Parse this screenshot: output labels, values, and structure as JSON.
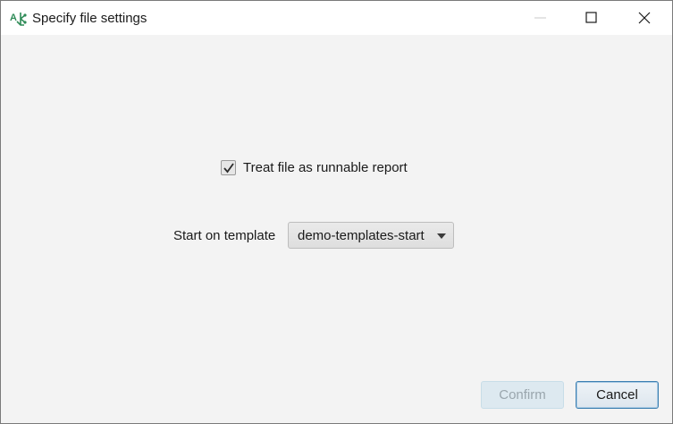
{
  "window": {
    "title": "Specify file settings",
    "icon": "app-logo-icon",
    "controls": {
      "minimize_icon": "minimize-icon",
      "maximize_icon": "maximize-icon",
      "close_icon": "close-icon"
    }
  },
  "settings": {
    "runnable_checkbox": {
      "label": "Treat file as runnable report",
      "checked": true
    },
    "template": {
      "label": "Start on template",
      "selected": "demo-templates-start"
    }
  },
  "footer": {
    "confirm_label": "Confirm",
    "confirm_enabled": false,
    "cancel_label": "Cancel"
  },
  "colors": {
    "background": "#f3f3f3",
    "titlebar": "#ffffff",
    "accent_border": "#3c7fb1",
    "disabled_button": "#dde9f0",
    "icon_green": "#2e8b57"
  }
}
